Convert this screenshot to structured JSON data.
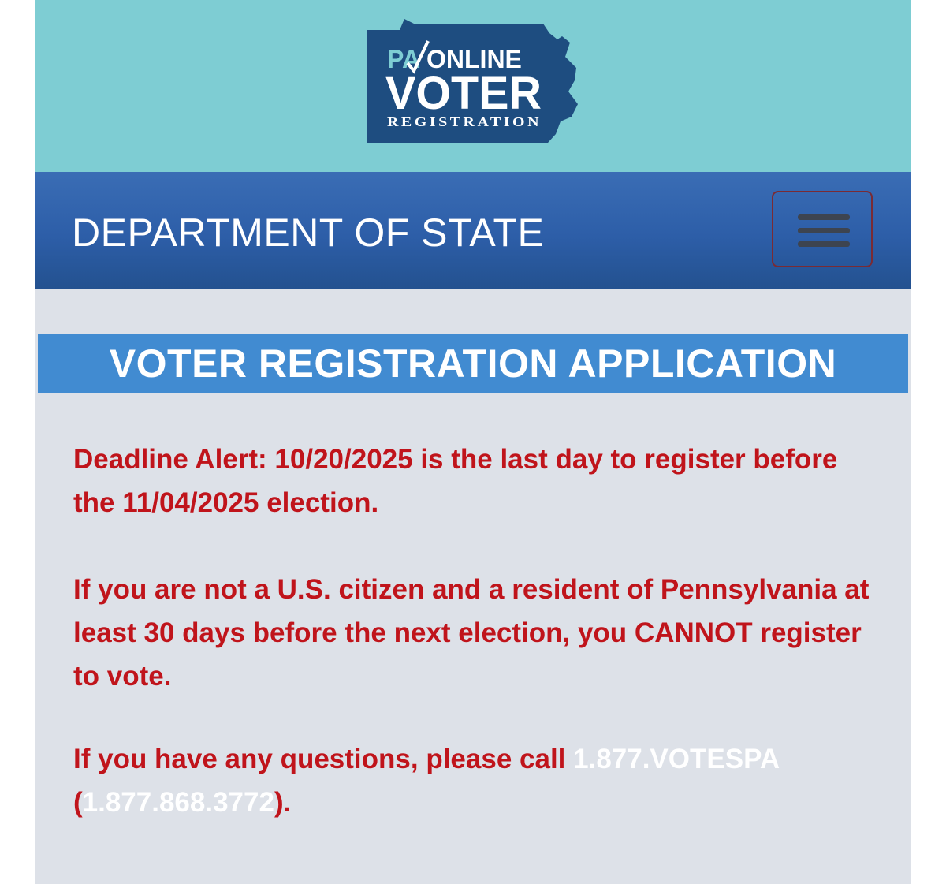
{
  "logo": {
    "line1_pa": "PA",
    "line1_online": "ONLINE",
    "line2": "VOTER",
    "line3": "REGISTRATION",
    "colors": {
      "state_shape": "#1e4d80",
      "pa_text": "#7ecdd3",
      "text": "#ffffff"
    }
  },
  "nav": {
    "title": "DEPARTMENT OF STATE",
    "menu_icon": "hamburger-icon"
  },
  "section": {
    "title": "VOTER REGISTRATION APPLICATION"
  },
  "notices": {
    "deadline": "Deadline Alert: 10/20/2025 is the last day to register before the 11/04/2025 election.",
    "eligibility": "If you are not a U.S. citizen and a resident of Pennsylvania at least 30 days before the next election, you CANNOT register to vote.",
    "questions_prefix": "If you have any questions, please call ",
    "phone_word": "1.877.VOTESPA",
    "paren_open": " (",
    "phone_number": "1.877.868.3772",
    "questions_suffix": ")."
  },
  "colors": {
    "logo_band": "#7ecdd3",
    "nav_bar": "#2d5ea8",
    "section_header": "#418bd1",
    "alert_text": "#c0141b",
    "page_bg": "#dde1e8"
  }
}
